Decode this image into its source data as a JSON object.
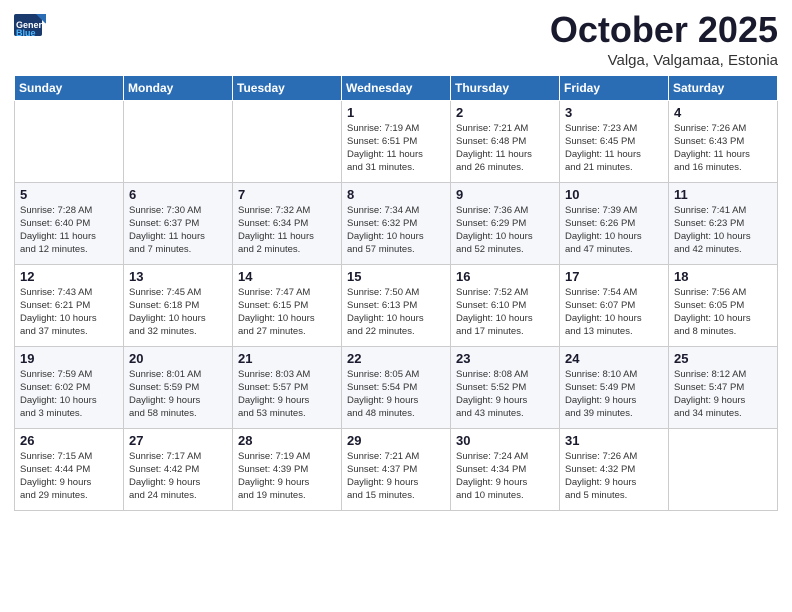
{
  "header": {
    "logo_general": "General",
    "logo_blue": "Blue",
    "month_title": "October 2025",
    "location": "Valga, Valgamaa, Estonia"
  },
  "weekdays": [
    "Sunday",
    "Monday",
    "Tuesday",
    "Wednesday",
    "Thursday",
    "Friday",
    "Saturday"
  ],
  "weeks": [
    [
      {
        "day": "",
        "info": ""
      },
      {
        "day": "",
        "info": ""
      },
      {
        "day": "",
        "info": ""
      },
      {
        "day": "1",
        "info": "Sunrise: 7:19 AM\nSunset: 6:51 PM\nDaylight: 11 hours\nand 31 minutes."
      },
      {
        "day": "2",
        "info": "Sunrise: 7:21 AM\nSunset: 6:48 PM\nDaylight: 11 hours\nand 26 minutes."
      },
      {
        "day": "3",
        "info": "Sunrise: 7:23 AM\nSunset: 6:45 PM\nDaylight: 11 hours\nand 21 minutes."
      },
      {
        "day": "4",
        "info": "Sunrise: 7:26 AM\nSunset: 6:43 PM\nDaylight: 11 hours\nand 16 minutes."
      }
    ],
    [
      {
        "day": "5",
        "info": "Sunrise: 7:28 AM\nSunset: 6:40 PM\nDaylight: 11 hours\nand 12 minutes."
      },
      {
        "day": "6",
        "info": "Sunrise: 7:30 AM\nSunset: 6:37 PM\nDaylight: 11 hours\nand 7 minutes."
      },
      {
        "day": "7",
        "info": "Sunrise: 7:32 AM\nSunset: 6:34 PM\nDaylight: 11 hours\nand 2 minutes."
      },
      {
        "day": "8",
        "info": "Sunrise: 7:34 AM\nSunset: 6:32 PM\nDaylight: 10 hours\nand 57 minutes."
      },
      {
        "day": "9",
        "info": "Sunrise: 7:36 AM\nSunset: 6:29 PM\nDaylight: 10 hours\nand 52 minutes."
      },
      {
        "day": "10",
        "info": "Sunrise: 7:39 AM\nSunset: 6:26 PM\nDaylight: 10 hours\nand 47 minutes."
      },
      {
        "day": "11",
        "info": "Sunrise: 7:41 AM\nSunset: 6:23 PM\nDaylight: 10 hours\nand 42 minutes."
      }
    ],
    [
      {
        "day": "12",
        "info": "Sunrise: 7:43 AM\nSunset: 6:21 PM\nDaylight: 10 hours\nand 37 minutes."
      },
      {
        "day": "13",
        "info": "Sunrise: 7:45 AM\nSunset: 6:18 PM\nDaylight: 10 hours\nand 32 minutes."
      },
      {
        "day": "14",
        "info": "Sunrise: 7:47 AM\nSunset: 6:15 PM\nDaylight: 10 hours\nand 27 minutes."
      },
      {
        "day": "15",
        "info": "Sunrise: 7:50 AM\nSunset: 6:13 PM\nDaylight: 10 hours\nand 22 minutes."
      },
      {
        "day": "16",
        "info": "Sunrise: 7:52 AM\nSunset: 6:10 PM\nDaylight: 10 hours\nand 17 minutes."
      },
      {
        "day": "17",
        "info": "Sunrise: 7:54 AM\nSunset: 6:07 PM\nDaylight: 10 hours\nand 13 minutes."
      },
      {
        "day": "18",
        "info": "Sunrise: 7:56 AM\nSunset: 6:05 PM\nDaylight: 10 hours\nand 8 minutes."
      }
    ],
    [
      {
        "day": "19",
        "info": "Sunrise: 7:59 AM\nSunset: 6:02 PM\nDaylight: 10 hours\nand 3 minutes."
      },
      {
        "day": "20",
        "info": "Sunrise: 8:01 AM\nSunset: 5:59 PM\nDaylight: 9 hours\nand 58 minutes."
      },
      {
        "day": "21",
        "info": "Sunrise: 8:03 AM\nSunset: 5:57 PM\nDaylight: 9 hours\nand 53 minutes."
      },
      {
        "day": "22",
        "info": "Sunrise: 8:05 AM\nSunset: 5:54 PM\nDaylight: 9 hours\nand 48 minutes."
      },
      {
        "day": "23",
        "info": "Sunrise: 8:08 AM\nSunset: 5:52 PM\nDaylight: 9 hours\nand 43 minutes."
      },
      {
        "day": "24",
        "info": "Sunrise: 8:10 AM\nSunset: 5:49 PM\nDaylight: 9 hours\nand 39 minutes."
      },
      {
        "day": "25",
        "info": "Sunrise: 8:12 AM\nSunset: 5:47 PM\nDaylight: 9 hours\nand 34 minutes."
      }
    ],
    [
      {
        "day": "26",
        "info": "Sunrise: 7:15 AM\nSunset: 4:44 PM\nDaylight: 9 hours\nand 29 minutes."
      },
      {
        "day": "27",
        "info": "Sunrise: 7:17 AM\nSunset: 4:42 PM\nDaylight: 9 hours\nand 24 minutes."
      },
      {
        "day": "28",
        "info": "Sunrise: 7:19 AM\nSunset: 4:39 PM\nDaylight: 9 hours\nand 19 minutes."
      },
      {
        "day": "29",
        "info": "Sunrise: 7:21 AM\nSunset: 4:37 PM\nDaylight: 9 hours\nand 15 minutes."
      },
      {
        "day": "30",
        "info": "Sunrise: 7:24 AM\nSunset: 4:34 PM\nDaylight: 9 hours\nand 10 minutes."
      },
      {
        "day": "31",
        "info": "Sunrise: 7:26 AM\nSunset: 4:32 PM\nDaylight: 9 hours\nand 5 minutes."
      },
      {
        "day": "",
        "info": ""
      }
    ]
  ]
}
